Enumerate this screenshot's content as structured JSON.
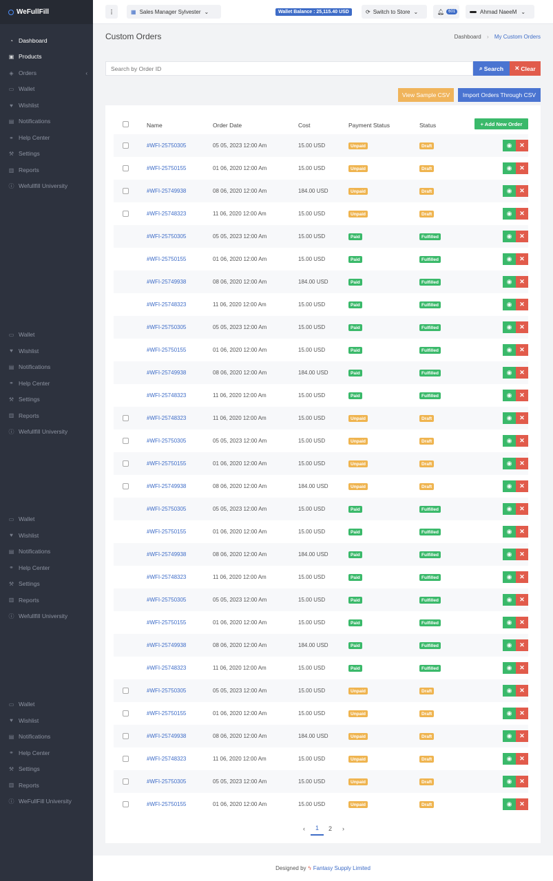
{
  "brand": {
    "name": "WeFullFill"
  },
  "sidebar": {
    "primary": [
      {
        "label": "Dashboard",
        "icon": "dashboard-icon"
      },
      {
        "label": "Products",
        "icon": "gift-icon"
      },
      {
        "label": "Orders",
        "icon": "box-icon"
      },
      {
        "label": "Wallet",
        "icon": "wallet-icon"
      },
      {
        "label": "Wishlist",
        "icon": "heart-icon"
      },
      {
        "label": "Notifications",
        "icon": "bell-icon"
      },
      {
        "label": "Help Center",
        "icon": "handshake-icon"
      },
      {
        "label": "Settings",
        "icon": "wrench-icon"
      },
      {
        "label": "Reports",
        "icon": "bar-chart-icon"
      },
      {
        "label": "Wefullfill University",
        "icon": "info-icon"
      }
    ],
    "repeat_group_a": [
      {
        "label": "Wallet",
        "icon": "wallet-icon"
      },
      {
        "label": "Wishlist",
        "icon": "heart-icon"
      },
      {
        "label": "Notifications",
        "icon": "bell-icon"
      },
      {
        "label": "Help Center",
        "icon": "handshake-icon"
      },
      {
        "label": "Settings",
        "icon": "wrench-icon"
      },
      {
        "label": "Reports",
        "icon": "bar-chart-icon"
      },
      {
        "label": "Wefullfill University",
        "icon": "info-icon"
      }
    ],
    "repeat_group_b": [
      {
        "label": "Wallet",
        "icon": "wallet-icon"
      },
      {
        "label": "Wishlist",
        "icon": "heart-icon"
      },
      {
        "label": "Notifications",
        "icon": "bell-icon"
      },
      {
        "label": "Help Center",
        "icon": "handshake-icon"
      },
      {
        "label": "Settings",
        "icon": "wrench-icon"
      },
      {
        "label": "Reports",
        "icon": "bar-chart-icon"
      },
      {
        "label": "Wefullfill University",
        "icon": "info-icon"
      }
    ],
    "repeat_group_c": [
      {
        "label": "Wallet",
        "icon": "wallet-icon"
      },
      {
        "label": "Wishlist",
        "icon": "heart-icon"
      },
      {
        "label": "Notifications",
        "icon": "bell-icon"
      },
      {
        "label": "Help Center",
        "icon": "handshake-icon"
      },
      {
        "label": "Settings",
        "icon": "wrench-icon"
      },
      {
        "label": "Reports",
        "icon": "bar-chart-icon"
      },
      {
        "label": "WeFullFill University",
        "icon": "info-icon"
      }
    ]
  },
  "topbar": {
    "manager": "Sales Manager Sylvester",
    "wallet_balance": "Wallet Balance : 25,115.40 USD",
    "switch_store": "Switch to Store",
    "notification_count": "601",
    "user_name": "Ahmad NaeeM"
  },
  "page": {
    "title": "Custom Orders",
    "breadcrumb": [
      "Dashboard",
      "My Custom Orders"
    ]
  },
  "search": {
    "placeholder": "Search by Order ID",
    "search_label": "Search",
    "clear_label": "Clear"
  },
  "actions": {
    "sample_csv": "View Sample CSV",
    "import_csv": "Import Orders Through CSV",
    "add_order": "+ Add New Order"
  },
  "table": {
    "columns": [
      "Name",
      "Order Date",
      "Cost",
      "Payment Status",
      "Status"
    ],
    "rows": [
      {
        "name": "#WFI-25750305",
        "date": "05 05, 2023 12:00 Am",
        "cost": "15.00 USD",
        "payment": "Unpaid",
        "status": "Draft",
        "checkbox": true
      },
      {
        "name": "#WFI-25750155",
        "date": "01 06, 2020 12:00 Am",
        "cost": "15.00 USD",
        "payment": "Unpaid",
        "status": "Draft",
        "checkbox": true
      },
      {
        "name": "#WFI-25749938",
        "date": "08 06, 2020 12:00 Am",
        "cost": "184.00 USD",
        "payment": "Unpaid",
        "status": "Draft",
        "checkbox": true
      },
      {
        "name": "#WFI-25748323",
        "date": "11 06, 2020 12:00 Am",
        "cost": "15.00 USD",
        "payment": "Unpaid",
        "status": "Draft",
        "checkbox": true
      },
      {
        "name": "#WFI-25750305",
        "date": "05 05, 2023 12:00 Am",
        "cost": "15.00 USD",
        "payment": "Paid",
        "status": "Fulfilled",
        "checkbox": false
      },
      {
        "name": "#WFI-25750155",
        "date": "01 06, 2020 12:00 Am",
        "cost": "15.00 USD",
        "payment": "Paid",
        "status": "Fulfilled",
        "checkbox": false
      },
      {
        "name": "#WFI-25749938",
        "date": "08 06, 2020 12:00 Am",
        "cost": "184.00 USD",
        "payment": "Paid",
        "status": "Fulfilled",
        "checkbox": false
      },
      {
        "name": "#WFI-25748323",
        "date": "11 06, 2020 12:00 Am",
        "cost": "15.00 USD",
        "payment": "Paid",
        "status": "Fulfilled",
        "checkbox": false
      },
      {
        "name": "#WFI-25750305",
        "date": "05 05, 2023 12:00 Am",
        "cost": "15.00 USD",
        "payment": "Paid",
        "status": "Fulfilled",
        "checkbox": false
      },
      {
        "name": "#WFI-25750155",
        "date": "01 06, 2020 12:00 Am",
        "cost": "15.00 USD",
        "payment": "Paid",
        "status": "Fulfilled",
        "checkbox": false
      },
      {
        "name": "#WFI-25749938",
        "date": "08 06, 2020 12:00 Am",
        "cost": "184.00 USD",
        "payment": "Paid",
        "status": "Fulfilled",
        "checkbox": false
      },
      {
        "name": "#WFI-25748323",
        "date": "11 06, 2020 12:00 Am",
        "cost": "15.00 USD",
        "payment": "Paid",
        "status": "Fulfilled",
        "checkbox": false
      },
      {
        "name": "#WFI-25748323",
        "date": "11 06, 2020 12:00 Am",
        "cost": "15.00 USD",
        "payment": "Unpaid",
        "status": "Draft",
        "checkbox": true
      },
      {
        "name": "#WFI-25750305",
        "date": "05 05, 2023 12:00 Am",
        "cost": "15.00 USD",
        "payment": "Unpaid",
        "status": "Draft",
        "checkbox": true
      },
      {
        "name": "#WFI-25750155",
        "date": "01 06, 2020 12:00 Am",
        "cost": "15.00 USD",
        "payment": "Unpaid",
        "status": "Draft",
        "checkbox": true
      },
      {
        "name": "#WFI-25749938",
        "date": "08 06, 2020 12:00 Am",
        "cost": "184.00 USD",
        "payment": "Unpaid",
        "status": "Draft",
        "checkbox": true
      },
      {
        "name": "#WFI-25750305",
        "date": "05 05, 2023 12:00 Am",
        "cost": "15.00 USD",
        "payment": "Paid",
        "status": "Fulfilled",
        "checkbox": false
      },
      {
        "name": "#WFI-25750155",
        "date": "01 06, 2020 12:00 Am",
        "cost": "15.00 USD",
        "payment": "Paid",
        "status": "Fulfilled",
        "checkbox": false
      },
      {
        "name": "#WFI-25749938",
        "date": "08 06, 2020 12:00 Am",
        "cost": "184.00 USD",
        "payment": "Paid",
        "status": "Fulfilled",
        "checkbox": false
      },
      {
        "name": "#WFI-25748323",
        "date": "11 06, 2020 12:00 Am",
        "cost": "15.00 USD",
        "payment": "Paid",
        "status": "Fulfilled",
        "checkbox": false
      },
      {
        "name": "#WFI-25750305",
        "date": "05 05, 2023 12:00 Am",
        "cost": "15.00 USD",
        "payment": "Paid",
        "status": "Fulfilled",
        "checkbox": false
      },
      {
        "name": "#WFI-25750155",
        "date": "01 06, 2020 12:00 Am",
        "cost": "15.00 USD",
        "payment": "Paid",
        "status": "Fulfilled",
        "checkbox": false
      },
      {
        "name": "#WFI-25749938",
        "date": "08 06, 2020 12:00 Am",
        "cost": "184.00 USD",
        "payment": "Paid",
        "status": "Fulfilled",
        "checkbox": false
      },
      {
        "name": "#WFI-25748323",
        "date": "11 06, 2020 12:00 Am",
        "cost": "15.00 USD",
        "payment": "Paid",
        "status": "Fulfilled",
        "checkbox": false
      },
      {
        "name": "#WFI-25750305",
        "date": "05 05, 2023 12:00 Am",
        "cost": "15.00 USD",
        "payment": "Unpaid",
        "status": "Draft",
        "checkbox": true
      },
      {
        "name": "#WFI-25750155",
        "date": "01 06, 2020 12:00 Am",
        "cost": "15.00 USD",
        "payment": "Unpaid",
        "status": "Draft",
        "checkbox": true
      },
      {
        "name": "#WFI-25749938",
        "date": "08 06, 2020 12:00 Am",
        "cost": "184.00 USD",
        "payment": "Unpaid",
        "status": "Draft",
        "checkbox": true
      },
      {
        "name": "#WFI-25748323",
        "date": "11 06, 2020 12:00 Am",
        "cost": "15.00 USD",
        "payment": "Unpaid",
        "status": "Draft",
        "checkbox": true
      },
      {
        "name": "#WFI-25750305",
        "date": "05 05, 2023 12:00 Am",
        "cost": "15.00 USD",
        "payment": "Unpaid",
        "status": "Draft",
        "checkbox": true
      },
      {
        "name": "#WFI-25750155",
        "date": "01 06, 2020 12:00 Am",
        "cost": "15.00 USD",
        "payment": "Unpaid",
        "status": "Draft",
        "checkbox": true
      }
    ]
  },
  "pagination": {
    "prev": "‹",
    "pages": [
      "1",
      "2"
    ],
    "current": "1",
    "next": "›"
  },
  "footer": {
    "prefix": "Designed by",
    "company": "Fantasy Supply Limited"
  },
  "colors": {
    "accent": "#3e6cc7",
    "success": "#3ab96a",
    "warning": "#efb44f",
    "danger": "#e15b4b",
    "sidebar": "#2d323e"
  }
}
